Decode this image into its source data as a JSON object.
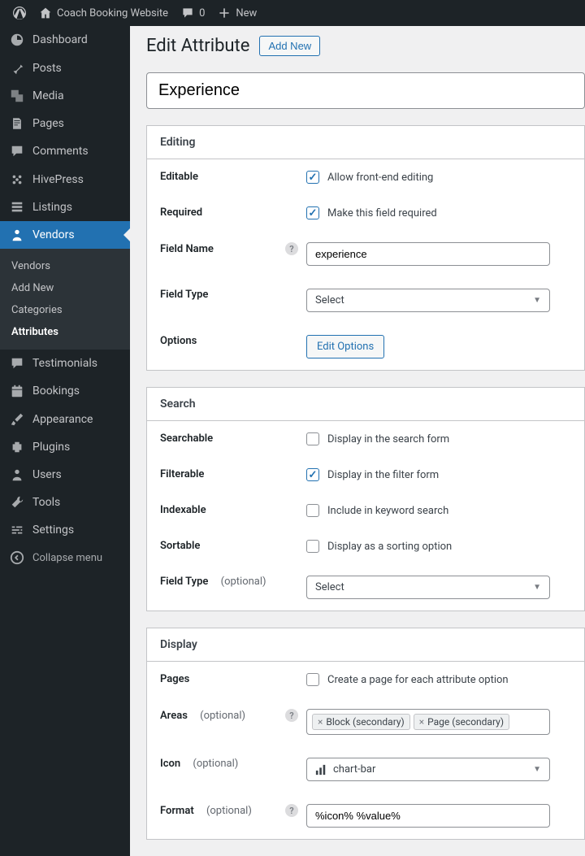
{
  "topbar": {
    "site_name": "Coach Booking Website",
    "comments_count": "0",
    "new_label": "New"
  },
  "sidebar": {
    "items": [
      {
        "label": "Dashboard",
        "icon": "dashboard"
      },
      {
        "label": "Posts",
        "icon": "pin"
      },
      {
        "label": "Media",
        "icon": "media"
      },
      {
        "label": "Pages",
        "icon": "pages"
      },
      {
        "label": "Comments",
        "icon": "comment"
      },
      {
        "label": "HivePress",
        "icon": "hivepress"
      },
      {
        "label": "Listings",
        "icon": "listings"
      },
      {
        "label": "Vendors",
        "icon": "vendors",
        "active": true
      },
      {
        "label": "Testimonials",
        "icon": "testimonials"
      },
      {
        "label": "Bookings",
        "icon": "bookings"
      },
      {
        "label": "Appearance",
        "icon": "brush"
      },
      {
        "label": "Plugins",
        "icon": "plugin"
      },
      {
        "label": "Users",
        "icon": "user"
      },
      {
        "label": "Tools",
        "icon": "tools"
      },
      {
        "label": "Settings",
        "icon": "settings"
      }
    ],
    "sub_items": [
      "Vendors",
      "Add New",
      "Categories",
      "Attributes"
    ],
    "sub_active": "Attributes",
    "collapse_label": "Collapse menu"
  },
  "page": {
    "title": "Edit Attribute",
    "add_new": "Add New",
    "title_value": "Experience"
  },
  "editing": {
    "heading": "Editing",
    "editable_label": "Editable",
    "editable_desc": "Allow front-end editing",
    "editable_checked": true,
    "required_label": "Required",
    "required_desc": "Make this field required",
    "required_checked": true,
    "field_name_label": "Field Name",
    "field_name_value": "experience",
    "field_type_label": "Field Type",
    "field_type_value": "Select",
    "options_label": "Options",
    "options_btn": "Edit Options"
  },
  "search": {
    "heading": "Search",
    "searchable_label": "Searchable",
    "searchable_desc": "Display in the search form",
    "searchable_checked": false,
    "filterable_label": "Filterable",
    "filterable_desc": "Display in the filter form",
    "filterable_checked": true,
    "indexable_label": "Indexable",
    "indexable_desc": "Include in keyword search",
    "indexable_checked": false,
    "sortable_label": "Sortable",
    "sortable_desc": "Display as a sorting option",
    "sortable_checked": false,
    "field_type_label": "Field Type",
    "field_type_optional": "(optional)",
    "field_type_value": "Select"
  },
  "display": {
    "heading": "Display",
    "pages_label": "Pages",
    "pages_desc": "Create a page for each attribute option",
    "pages_checked": false,
    "areas_label": "Areas",
    "areas_optional": "(optional)",
    "areas_tags": [
      "Block (secondary)",
      "Page (secondary)"
    ],
    "icon_label": "Icon",
    "icon_optional": "(optional)",
    "icon_value": "chart-bar",
    "format_label": "Format",
    "format_optional": "(optional)",
    "format_value": "%icon% %value%"
  }
}
